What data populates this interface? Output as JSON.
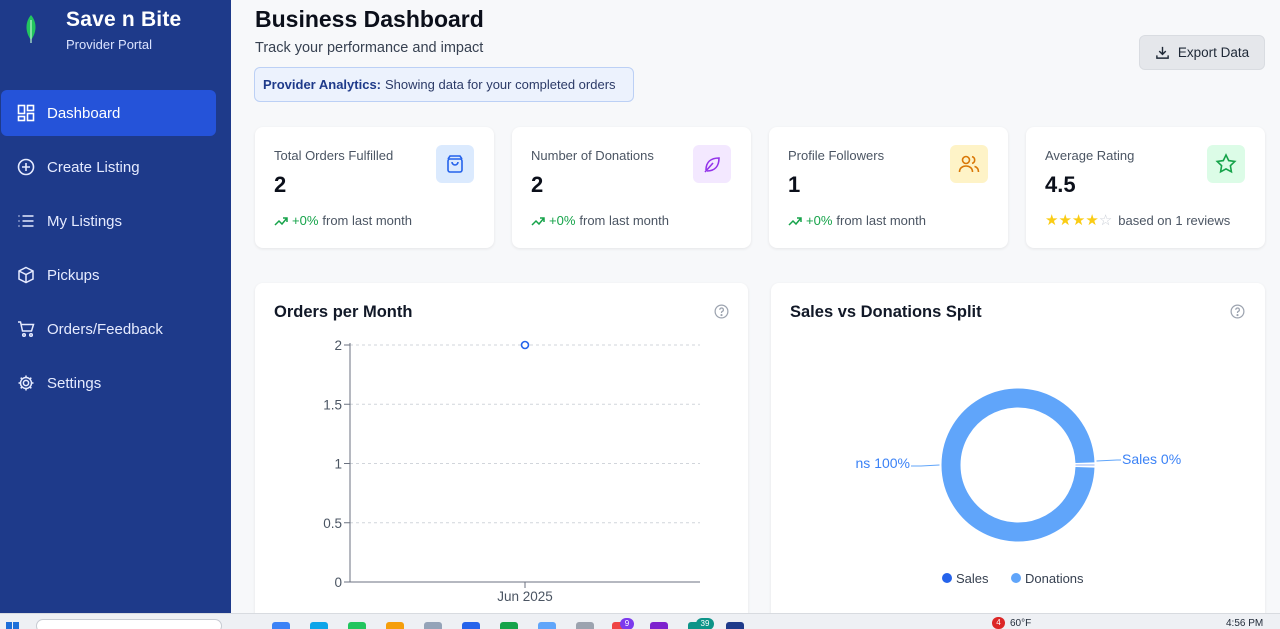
{
  "brand": {
    "name": "Save n Bite",
    "subtitle": "Provider Portal"
  },
  "sidebar": {
    "items": [
      {
        "label": "Dashboard",
        "icon": "dashboard-icon",
        "active": true
      },
      {
        "label": "Create Listing",
        "icon": "plus-circle-icon"
      },
      {
        "label": "My Listings",
        "icon": "list-icon"
      },
      {
        "label": "Pickups",
        "icon": "package-icon"
      },
      {
        "label": "Orders/Feedback",
        "icon": "cart-icon"
      },
      {
        "label": "Settings",
        "icon": "gear-icon"
      }
    ]
  },
  "header": {
    "title": "Business Dashboard",
    "subtitle": "Track your performance and impact",
    "notice_bold": "Provider Analytics:",
    "notice_text": "Showing data for your completed orders",
    "export_label": "Export Data"
  },
  "stats": [
    {
      "label": "Total Orders Fulfilled",
      "value": "2",
      "trend": "+0%",
      "trend_text": "from last month",
      "icon": "shopping-bag-icon",
      "color": "#dbeafe",
      "icon_color": "#2563eb"
    },
    {
      "label": "Number of Donations",
      "value": "2",
      "trend": "+0%",
      "trend_text": "from last month",
      "icon": "leaf-icon",
      "color": "#f3e8ff",
      "icon_color": "#9333ea"
    },
    {
      "label": "Profile Followers",
      "value": "1",
      "trend": "+0%",
      "trend_text": "from last month",
      "icon": "users-icon",
      "color": "#fef3c7",
      "icon_color": "#d97706"
    },
    {
      "label": "Average Rating",
      "value": "4.5",
      "rating": 4.5,
      "trend_text": "based on 1 reviews",
      "icon": "star-icon",
      "color": "#dcfce7",
      "icon_color": "#16a34a"
    }
  ],
  "chart_data": [
    {
      "type": "line",
      "title": "Orders per Month",
      "categories": [
        "Jun 2025"
      ],
      "series": [
        {
          "values": [
            2
          ]
        }
      ],
      "yticks": [
        "0",
        "0.5",
        "1",
        "1.5",
        "2"
      ],
      "ylim": [
        0,
        2
      ],
      "grid": true,
      "color": "#2563eb"
    },
    {
      "type": "pie",
      "title": "Sales vs Donations Split",
      "labels": [
        "Sales",
        "Donations"
      ],
      "values": [
        0,
        100
      ],
      "slice_labels": [
        "Sales 0%",
        "ns 100%"
      ],
      "colors": [
        "#2563eb",
        "#60a5fa"
      ],
      "donut": true,
      "legend": "bottom"
    }
  ],
  "taskbar": {
    "temperature": "60°F",
    "time": "4:56 PM",
    "badge_weather": "4",
    "badge_a": "9",
    "badge_b": "39"
  }
}
